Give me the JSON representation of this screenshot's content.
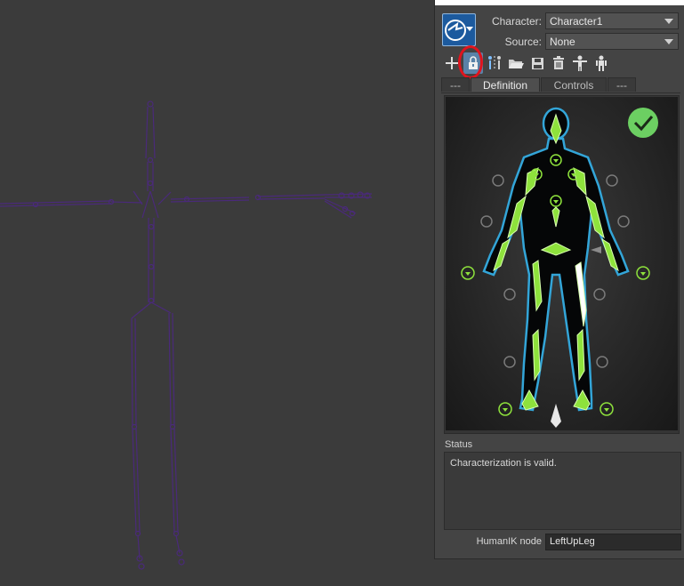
{
  "character_panel": {
    "character_label": "Character:",
    "character_value": "Character1",
    "source_label": "Source:",
    "source_value": "None"
  },
  "toolbar": {
    "icons": [
      "add-icon",
      "lock-icon",
      "mirror-icon",
      "open-folder-icon",
      "save-icon",
      "delete-icon",
      "t-pose-icon",
      "skeleton-icon"
    ],
    "active_icon": "lock-icon"
  },
  "tabs": [
    {
      "label": "---"
    },
    {
      "label": "Definition"
    },
    {
      "label": "Controls"
    },
    {
      "label": "---"
    }
  ],
  "status": {
    "title": "Status",
    "message": "Characterization is valid."
  },
  "humanik_node": {
    "label": "HumanIK node",
    "value": "LeftUpLeg"
  },
  "colors": {
    "viewport_bg": "#3b3b3b",
    "skeleton": "#4a2a7a",
    "bone_green": "#8ee23c",
    "valid_badge": "#6ccf62",
    "highlight_ring": "#e0141e"
  }
}
